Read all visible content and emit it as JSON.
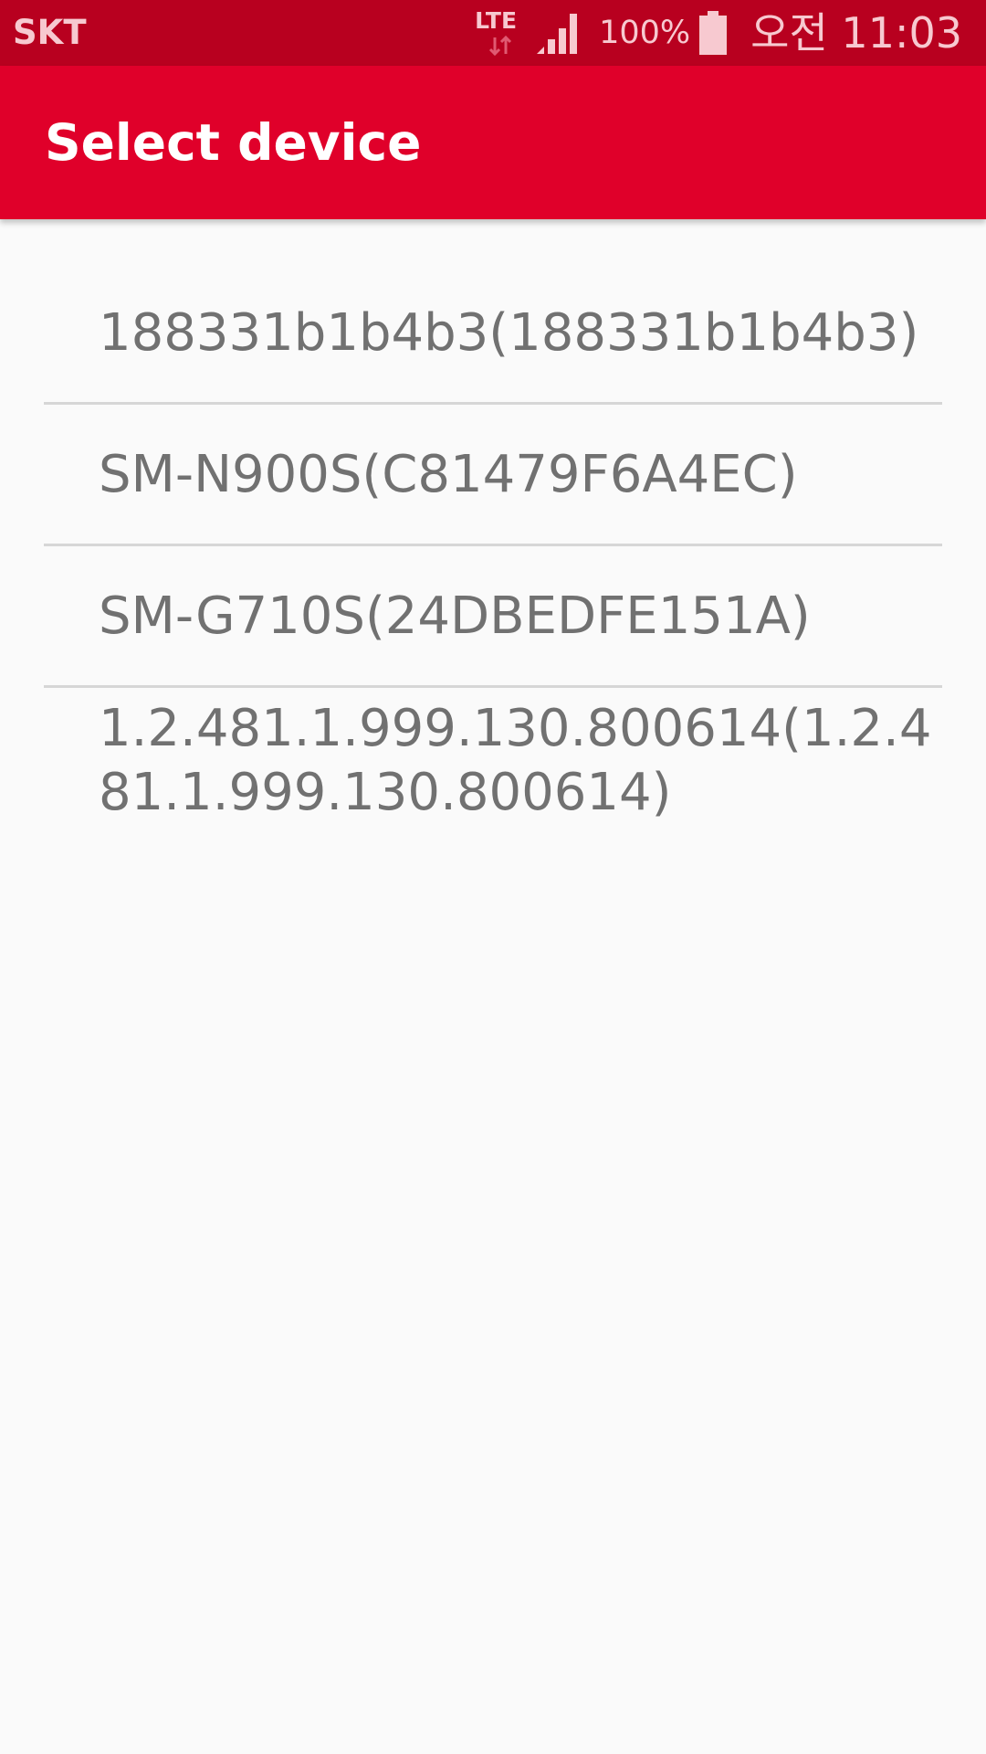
{
  "status_bar": {
    "carrier": "SKT",
    "network": "LTE",
    "battery_percent": "100%",
    "time": "오전 11:03",
    "icons": [
      "lte-data-arrows-icon",
      "signal-strength-icon",
      "battery-icon"
    ]
  },
  "app_bar": {
    "title": "Select device"
  },
  "devices": [
    {
      "label": "188331b1b4b3(188331b1b4b3)"
    },
    {
      "label": "SM-N900S(C81479F6A4EC)"
    },
    {
      "label": "SM-G710S(24DBEDFE151A)"
    },
    {
      "label": "1.2.481.1.999.130.800614(1.2.481.1.999.130.800614)"
    }
  ],
  "colors": {
    "status_bar": "#b8001f",
    "app_bar": "#e0002a",
    "background": "#fafafa",
    "item_text": "#717171",
    "divider": "#d6d6d6"
  }
}
